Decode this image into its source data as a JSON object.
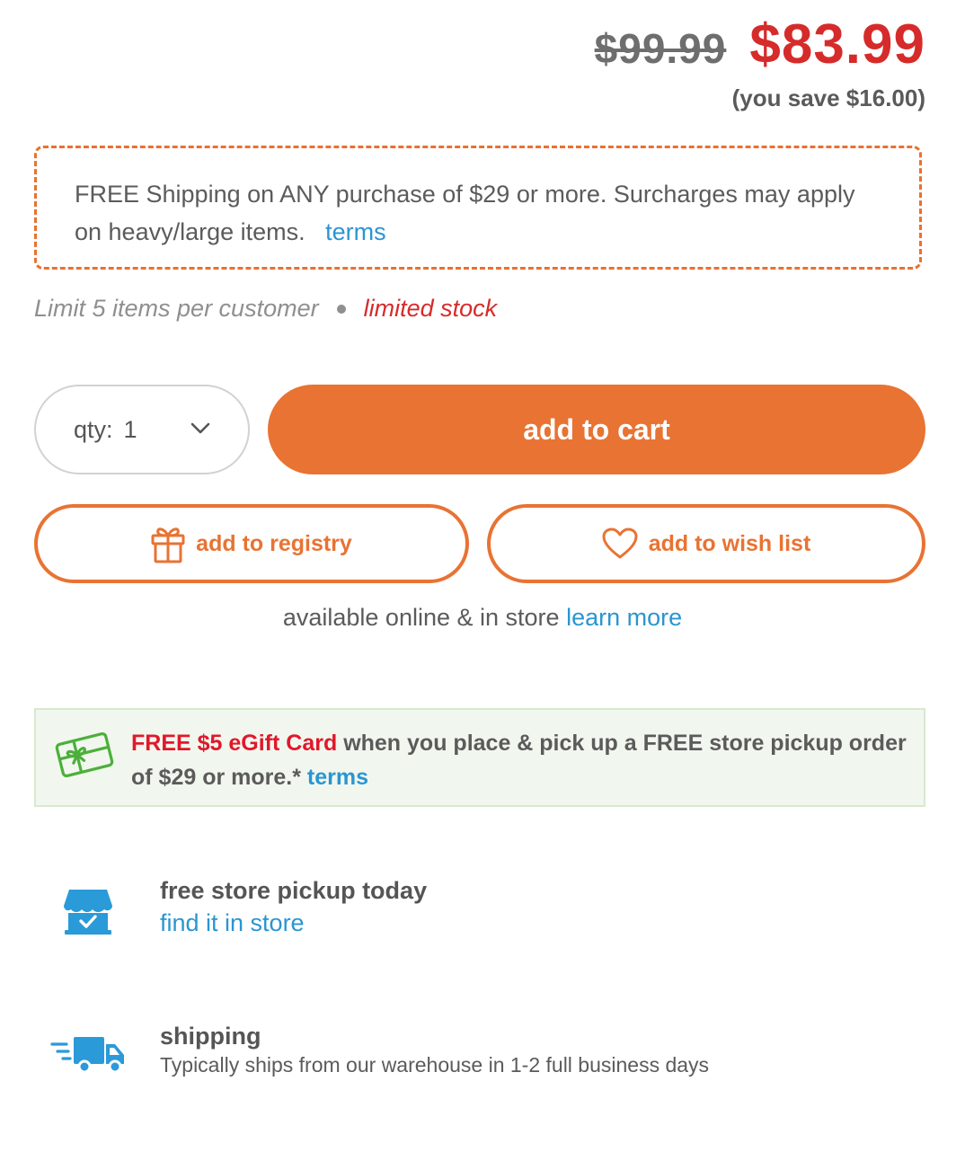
{
  "price": {
    "original": "$99.99",
    "sale": "$83.99",
    "savings": "(you save $16.00)"
  },
  "shipping_promo": {
    "text": "FREE Shipping on ANY purchase of $29 or more. Surcharges may apply on heavy/large items.",
    "link": "terms"
  },
  "limits": {
    "limit_text": "Limit 5 items per customer",
    "stock_text": "limited stock"
  },
  "purchase": {
    "qty_label": "qty:",
    "qty_value": "1",
    "add_to_cart": "add to cart",
    "add_to_registry": "add to registry",
    "add_to_wish_list": "add to wish list"
  },
  "availability": {
    "text": "available online & in store",
    "link": "learn more"
  },
  "egift": {
    "highlight": "FREE $5 eGift Card",
    "text": "when you place & pick up a FREE store pickup order of $29 or more.*",
    "link": "terms"
  },
  "pickup": {
    "title": "free store pickup today",
    "link": "find it in store"
  },
  "shipping": {
    "title": "shipping",
    "description": "Typically ships from our warehouse in 1-2 full business days"
  },
  "colors": {
    "accent_orange": "#e87333",
    "sale_red": "#d62b2b",
    "link_blue": "#2b95d1",
    "icon_blue": "#2a9ad8",
    "gift_green": "#4caf3b"
  },
  "icons": {
    "qty": "chevron-down-icon",
    "registry": "gift-icon",
    "wish_list": "heart-icon",
    "egift": "gift-card-icon",
    "pickup": "storefront-icon",
    "shipping": "delivery-truck-icon"
  }
}
